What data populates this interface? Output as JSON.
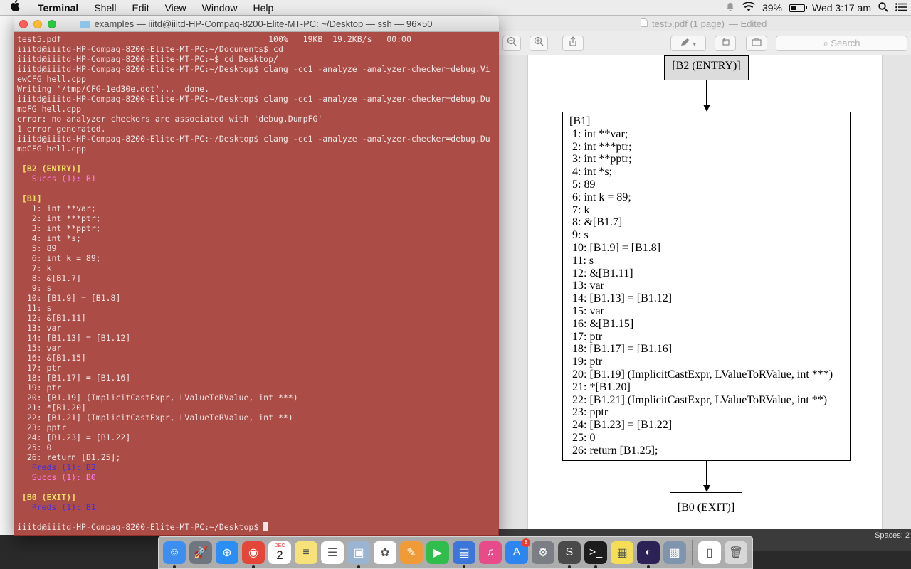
{
  "menubar": {
    "apple": "",
    "app": "Terminal",
    "items": [
      "Shell",
      "Edit",
      "View",
      "Window",
      "Help"
    ],
    "battery": "39%",
    "clock": "Wed 3:17 am"
  },
  "preview": {
    "title": "test5.pdf (1 page)",
    "title_suffix": "— Edited",
    "search_placeholder": "Search",
    "status_text": "Spaces: 2"
  },
  "cfg": {
    "entry_label": "[B2 (ENTRY)]",
    "b1_lines": [
      "[B1]",
      " 1: int **var;",
      " 2: int ***ptr;",
      " 3: int **pptr;",
      " 4: int *s;",
      " 5: 89",
      " 6: int k = 89;",
      " 7: k",
      " 8: &[B1.7]",
      " 9: s",
      " 10: [B1.9] = [B1.8]",
      " 11: s",
      " 12: &[B1.11]",
      " 13: var",
      " 14: [B1.13] = [B1.12]",
      " 15: var",
      " 16: &[B1.15]",
      " 17: ptr",
      " 18: [B1.17] = [B1.16]",
      " 19: ptr",
      " 20: [B1.19] (ImplicitCastExpr, LValueToRValue, int ***)",
      " 21: *[B1.20]",
      " 22: [B1.21] (ImplicitCastExpr, LValueToRValue, int **)",
      " 23: pptr",
      " 24: [B1.23] = [B1.22]",
      " 25: 0",
      " 26: return [B1.25];"
    ],
    "exit_label": "[B0 (EXIT)]"
  },
  "terminal": {
    "title": "examples — iiitd@iiitd-HP-Compaq-8200-Elite-MT-PC: ~/Desktop — ssh — 96×50",
    "lines": [
      {
        "t": "test5.pdf                                          100%   19KB  19.2KB/s   00:00",
        "c": ""
      },
      {
        "t": "iiitd@iiitd-HP-Compaq-8200-Elite-MT-PC:~/Documents$ cd",
        "c": ""
      },
      {
        "t": "iiitd@iiitd-HP-Compaq-8200-Elite-MT-PC:~$ cd Desktop/",
        "c": ""
      },
      {
        "t": "iiitd@iiitd-HP-Compaq-8200-Elite-MT-PC:~/Desktop$ clang -cc1 -analyze -analyzer-checker=debug.Vi",
        "c": ""
      },
      {
        "t": "ewCFG hell.cpp",
        "c": ""
      },
      {
        "t": "Writing '/tmp/CFG-1ed30e.dot'...  done.",
        "c": ""
      },
      {
        "t": "iiitd@iiitd-HP-Compaq-8200-Elite-MT-PC:~/Desktop$ clang -cc1 -analyze -analyzer-checker=debug.Du",
        "c": ""
      },
      {
        "t": "mpFG hell.cpp",
        "c": ""
      },
      {
        "t": "error: no analyzer checkers are associated with 'debug.DumpFG'",
        "c": ""
      },
      {
        "t": "1 error generated.",
        "c": ""
      },
      {
        "t": "iiitd@iiitd-HP-Compaq-8200-Elite-MT-PC:~/Desktop$ clang -cc1 -analyze -analyzer-checker=debug.Du",
        "c": ""
      },
      {
        "t": "mpCFG hell.cpp",
        "c": ""
      },
      {
        "t": "",
        "c": ""
      },
      {
        "t": " [B2 (ENTRY)]",
        "c": "yellow"
      },
      {
        "t": "   Succs (1): B1",
        "c": "magenta"
      },
      {
        "t": "",
        "c": ""
      },
      {
        "t": " [B1]",
        "c": "yellow"
      },
      {
        "t": "   1: int **var;",
        "c": ""
      },
      {
        "t": "   2: int ***ptr;",
        "c": ""
      },
      {
        "t": "   3: int **pptr;",
        "c": ""
      },
      {
        "t": "   4: int *s;",
        "c": ""
      },
      {
        "t": "   5: 89",
        "c": ""
      },
      {
        "t": "   6: int k = 89;",
        "c": ""
      },
      {
        "t": "   7: k",
        "c": ""
      },
      {
        "t": "   8: &[B1.7]",
        "c": ""
      },
      {
        "t": "   9: s",
        "c": ""
      },
      {
        "t": "  10: [B1.9] = [B1.8]",
        "c": ""
      },
      {
        "t": "  11: s",
        "c": ""
      },
      {
        "t": "  12: &[B1.11]",
        "c": ""
      },
      {
        "t": "  13: var",
        "c": ""
      },
      {
        "t": "  14: [B1.13] = [B1.12]",
        "c": ""
      },
      {
        "t": "  15: var",
        "c": ""
      },
      {
        "t": "  16: &[B1.15]",
        "c": ""
      },
      {
        "t": "  17: ptr",
        "c": ""
      },
      {
        "t": "  18: [B1.17] = [B1.16]",
        "c": ""
      },
      {
        "t": "  19: ptr",
        "c": ""
      },
      {
        "t": "  20: [B1.19] (ImplicitCastExpr, LValueToRValue, int ***)",
        "c": ""
      },
      {
        "t": "  21: *[B1.20]",
        "c": ""
      },
      {
        "t": "  22: [B1.21] (ImplicitCastExpr, LValueToRValue, int **)",
        "c": ""
      },
      {
        "t": "  23: pptr",
        "c": ""
      },
      {
        "t": "  24: [B1.23] = [B1.22]",
        "c": ""
      },
      {
        "t": "  25: 0",
        "c": ""
      },
      {
        "t": "  26: return [B1.25];",
        "c": ""
      },
      {
        "t": "   Preds (1): B2",
        "c": "blue"
      },
      {
        "t": "   Succs (1): B0",
        "c": "magenta"
      },
      {
        "t": "",
        "c": ""
      },
      {
        "t": " [B0 (EXIT)]",
        "c": "yellow"
      },
      {
        "t": "   Preds (1): B1",
        "c": "blue"
      },
      {
        "t": "",
        "c": ""
      }
    ],
    "prompt": "iiitd@iiitd-HP-Compaq-8200-Elite-MT-PC:~/Desktop$ "
  },
  "dock": {
    "calendar_month": "DEC",
    "calendar_day": "2",
    "appstore_badge": "8",
    "items": [
      {
        "name": "finder-icon",
        "bg": "#3d8ef0",
        "glyph": "☺",
        "dot": true
      },
      {
        "name": "launchpad-icon",
        "bg": "#6f7680",
        "glyph": "🚀",
        "dot": false
      },
      {
        "name": "safari-icon",
        "bg": "#2b8ef5",
        "glyph": "⊕",
        "dot": false
      },
      {
        "name": "chrome-icon",
        "bg": "#e5463a",
        "glyph": "◉",
        "dot": true
      },
      {
        "name": "calendar-icon",
        "bg": "#ffffff",
        "glyph": "",
        "dot": false
      },
      {
        "name": "notes-icon",
        "bg": "#f7e27a",
        "glyph": "≡",
        "dot": false
      },
      {
        "name": "reminders-icon",
        "bg": "#ffffff",
        "glyph": "☰",
        "dot": false
      },
      {
        "name": "preview-icon",
        "bg": "#9bb4d2",
        "glyph": "▣",
        "dot": true
      },
      {
        "name": "photos-icon",
        "bg": "#ffffff",
        "glyph": "✿",
        "dot": false
      },
      {
        "name": "pages-icon",
        "bg": "#f19a38",
        "glyph": "✎",
        "dot": false
      },
      {
        "name": "facetime-icon",
        "bg": "#2fbd4c",
        "glyph": "▶",
        "dot": false
      },
      {
        "name": "keynote-icon",
        "bg": "#3b76d8",
        "glyph": "▤",
        "dot": true
      },
      {
        "name": "itunes-icon",
        "bg": "#e84b8a",
        "glyph": "♫",
        "dot": false
      },
      {
        "name": "appstore-icon",
        "bg": "#2d86f0",
        "glyph": "A",
        "dot": false
      },
      {
        "name": "system-preferences-icon",
        "bg": "#7b7f85",
        "glyph": "⚙",
        "dot": false
      },
      {
        "name": "sublime-text-icon",
        "bg": "#4a4a4a",
        "glyph": "S",
        "dot": true
      },
      {
        "name": "terminal-icon",
        "bg": "#1d1d1d",
        "glyph": ">_",
        "dot": true
      },
      {
        "name": "stickies-icon",
        "bg": "#f5dd55",
        "glyph": "▦",
        "dot": false
      },
      {
        "name": "eclipse-icon",
        "bg": "#2c2255",
        "glyph": "◐",
        "dot": true
      },
      {
        "name": "image-capture-icon",
        "bg": "#7f95ad",
        "glyph": "▩",
        "dot": false
      },
      {
        "name": "documents-folder-icon",
        "bg": "#ffffff",
        "glyph": "▯",
        "dot": false
      },
      {
        "name": "trash-icon",
        "bg": "#d8d8d8",
        "glyph": "🗑",
        "dot": false
      }
    ]
  }
}
